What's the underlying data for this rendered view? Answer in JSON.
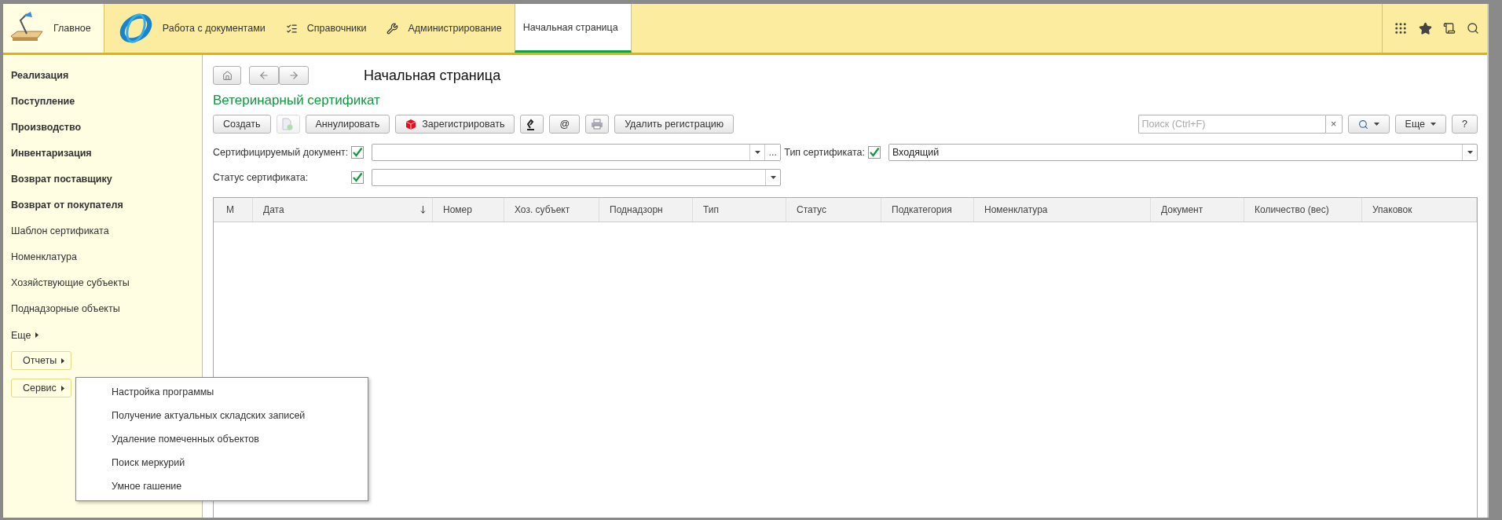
{
  "top_nav": {
    "sections": [
      {
        "kind": "home",
        "label": "Главное",
        "selected": false
      },
      {
        "kind": "logo",
        "label": "Работа с документами",
        "selected": false
      },
      {
        "kind": "catalog",
        "label": "Справочники",
        "selected": false
      },
      {
        "kind": "admin",
        "label": "Администрирование",
        "selected": false
      },
      {
        "kind": "page",
        "label": "Начальная страница",
        "selected": true
      }
    ]
  },
  "sidebar": {
    "items": [
      {
        "label": "Реализация",
        "kind": "group"
      },
      {
        "label": "Поступление",
        "kind": "group"
      },
      {
        "label": "Производство",
        "kind": "group"
      },
      {
        "label": "Инвентаризация",
        "kind": "group"
      },
      {
        "label": "Возврат поставщику",
        "kind": "group"
      },
      {
        "label": "Возврат от покупателя",
        "kind": "group"
      },
      {
        "label": "Шаблон сертификата",
        "kind": "link"
      },
      {
        "label": "Номенклатура",
        "kind": "link"
      },
      {
        "label": "Хозяйствующие субъекты",
        "kind": "link"
      },
      {
        "label": "Поднадзорные объекты",
        "kind": "link"
      }
    ],
    "more": "Еще",
    "buttons": [
      "Отчеты",
      "Сервис"
    ]
  },
  "page": {
    "title": "Начальная страница",
    "form_title": "Ветеринарный сертификат",
    "toolbar": [
      {
        "kind": "text",
        "label": "Создать",
        "disabled": false
      },
      {
        "kind": "icon",
        "disabled": true
      },
      {
        "kind": "text",
        "label": "Аннулировать",
        "disabled": false
      },
      {
        "kind": "icon_text",
        "label": "Зарегистрировать",
        "disabled": false
      },
      {
        "kind": "icon",
        "disabled": false
      },
      {
        "kind": "text",
        "label": "@",
        "disabled": false
      },
      {
        "kind": "icon",
        "disabled": false
      },
      {
        "kind": "text",
        "label": "Удалить регистрацию",
        "disabled": false
      }
    ],
    "search": {
      "placeholder": "Поиск (Ctrl+F)",
      "clear": "×"
    },
    "more_button": "Еще",
    "help_button": "?",
    "filters": [
      {
        "label": "Сертифицируемый документ:",
        "checked": true,
        "kind": "choice",
        "select_button": "..."
      },
      {
        "label": "Тип сертификата:",
        "checked": true,
        "kind": "list",
        "value": "Входящий"
      },
      {
        "label": "Статус сертификата:",
        "checked": true,
        "kind": "list"
      }
    ],
    "table": {
      "columns": [
        {
          "label": "М",
          "sorted": false
        },
        {
          "label": "Дата",
          "sorted": true
        },
        {
          "label": "Номер",
          "sorted": false
        },
        {
          "label": "Хоз. субъект",
          "sorted": false
        },
        {
          "label": "Поднадзорн",
          "sorted": false
        },
        {
          "label": "Тип",
          "sorted": false
        },
        {
          "label": "Статус",
          "sorted": false
        },
        {
          "label": "Подкатегория",
          "sorted": false
        },
        {
          "label": "Номенклатура",
          "sorted": false
        },
        {
          "label": "Документ",
          "sorted": false
        },
        {
          "label": "Количество (вес)",
          "sorted": false
        },
        {
          "label": "Упаковок",
          "sorted": false
        }
      ]
    }
  },
  "popup_menu": {
    "items": [
      "Настройка программы",
      "Получение актуальных складских записей",
      "Удаление помеченных объектов",
      "Поиск меркурий",
      "Умное гашение"
    ]
  }
}
